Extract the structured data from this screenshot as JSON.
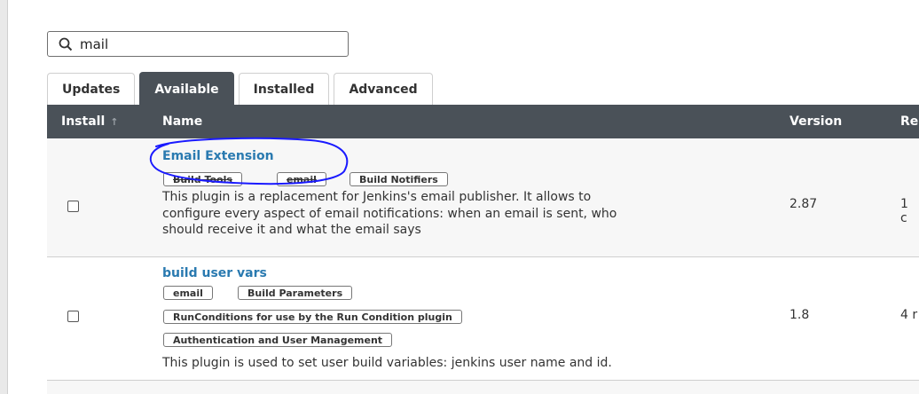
{
  "search": {
    "value": "mail",
    "icon": "search-icon"
  },
  "tabs": [
    {
      "label": "Updates",
      "active": false
    },
    {
      "label": "Available",
      "active": true
    },
    {
      "label": "Installed",
      "active": false
    },
    {
      "label": "Advanced",
      "active": false
    }
  ],
  "table": {
    "headers": {
      "install": "Install",
      "install_sort": "↑",
      "name": "Name",
      "version": "Version",
      "released": "Re"
    },
    "rows": [
      {
        "name": "Email Extension",
        "tags": [
          "Build Tools",
          "email",
          "Build Notifiers"
        ],
        "description": [
          "This plugin is a replacement for Jenkins's email publisher. It allows to",
          "configure every aspect of email notifications: when an email is sent, who",
          "should receive it and what the email says"
        ],
        "version": "2.87",
        "released": "1 c"
      },
      {
        "name": "build user vars",
        "tags": [
          "email",
          "Build Parameters",
          "RunConditions for use by the Run Condition plugin",
          "Authentication and User Management"
        ],
        "description": [
          "This plugin is used to set user build variables: jenkins user name and id."
        ],
        "version": "1.8",
        "released": "4 r"
      }
    ]
  },
  "colors": {
    "header_bg": "#4a5158",
    "link": "#2a7ab0",
    "annotation": "#1a1aff"
  }
}
